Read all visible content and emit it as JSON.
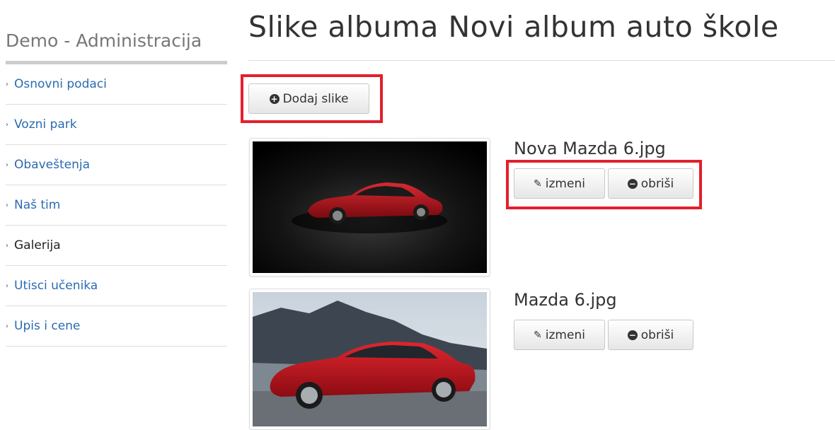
{
  "sidebar": {
    "title": "Demo - Administracija",
    "items": [
      {
        "label": "Osnovni podaci"
      },
      {
        "label": "Vozni park"
      },
      {
        "label": "Obaveštenja"
      },
      {
        "label": "Naš tim"
      },
      {
        "label": "Galerija"
      },
      {
        "label": "Utisci učenika"
      },
      {
        "label": "Upis i cene"
      }
    ],
    "active_label": "Galerija"
  },
  "main": {
    "title": "Slike albuma Novi album auto škole",
    "add_button_label": "Dodaj slike",
    "photos": [
      {
        "filename": "Nova Mazda 6.jpg",
        "edit_label": "izmeni",
        "delete_label": "obriši"
      },
      {
        "filename": "Mazda 6.jpg",
        "edit_label": "izmeni",
        "delete_label": "obriši"
      }
    ]
  },
  "colors": {
    "link": "#2a6bb0",
    "highlight": "#e3202b",
    "car_red": "#b0121c"
  },
  "icons": {
    "nav_bullet": "chevron-right-icon",
    "add": "plus-circle-icon",
    "edit": "pencil-icon",
    "delete": "minus-circle-icon"
  }
}
